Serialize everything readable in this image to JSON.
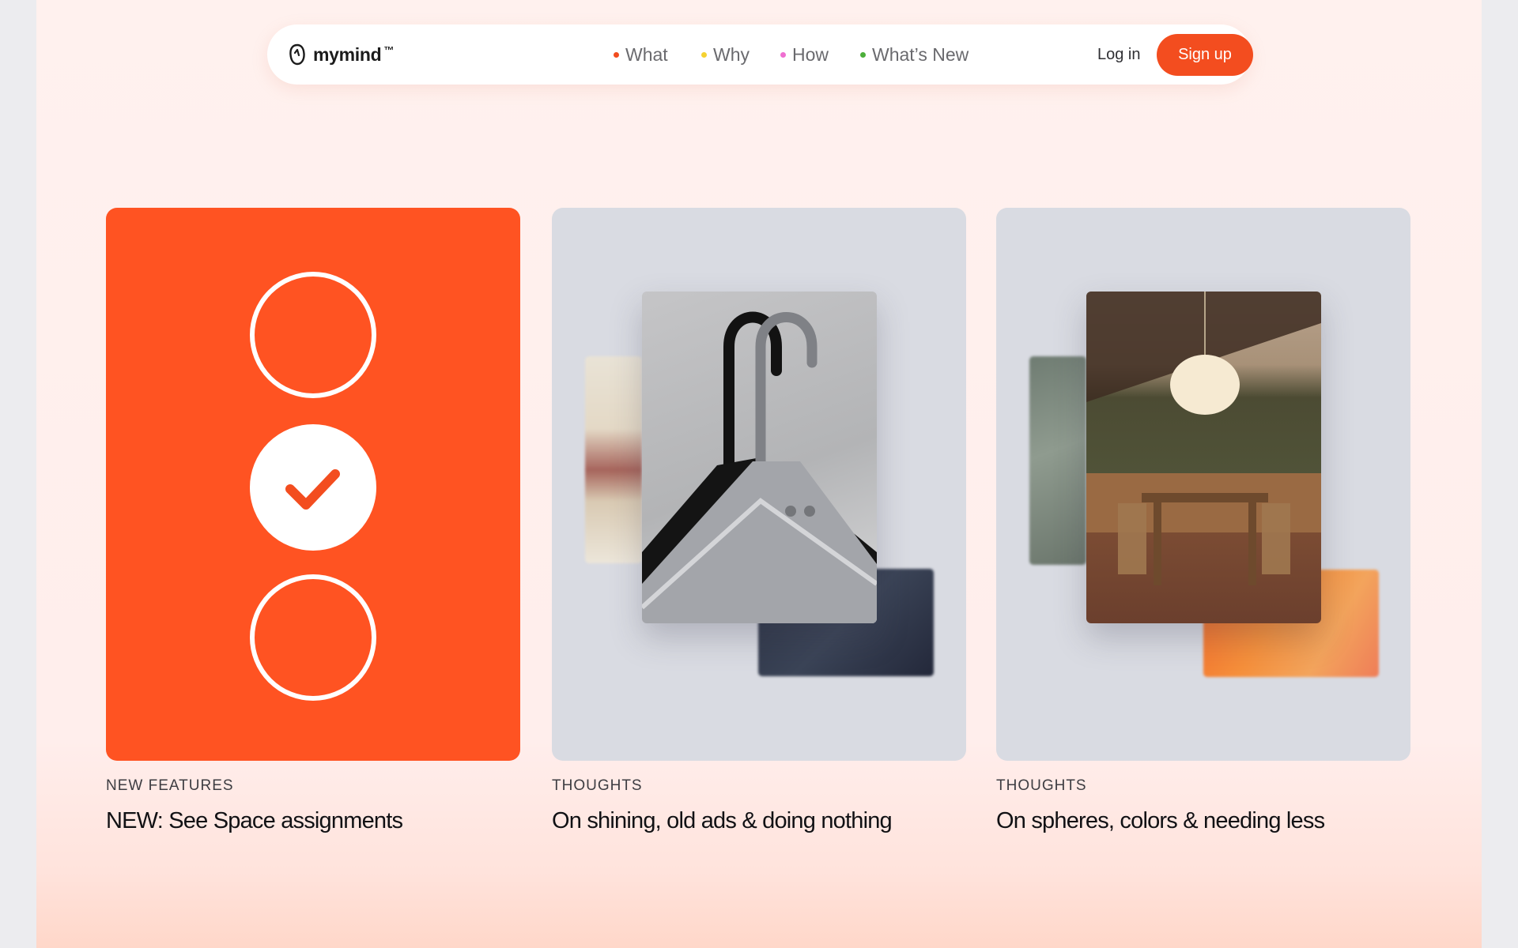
{
  "brand": {
    "name": "mymind",
    "trademark": "™"
  },
  "nav": {
    "links": [
      {
        "label": "What",
        "dot_color": "#f24c1e"
      },
      {
        "label": "Why",
        "dot_color": "#f5d231"
      },
      {
        "label": "How",
        "dot_color": "#ef6fd1"
      },
      {
        "label": "What’s New",
        "dot_color": "#4caf3a"
      }
    ],
    "login": "Log in",
    "signup": "Sign up"
  },
  "colors": {
    "accent": "#f34d1f",
    "card_orange": "#ff5322",
    "card_gray": "#d9dbe2"
  },
  "cards": [
    {
      "category": "NEW FEATURES",
      "title": "NEW: See Space assignments",
      "icons": [
        "circle-icon",
        "check-circle-icon",
        "circle-icon"
      ]
    },
    {
      "category": "THOUGHTS",
      "title": "On shining, old ads & doing nothing",
      "image": "clothes-hanger-photo"
    },
    {
      "category": "THOUGHTS",
      "title": "On spheres, colors & needing less",
      "image": "dining-room-photo"
    }
  ]
}
